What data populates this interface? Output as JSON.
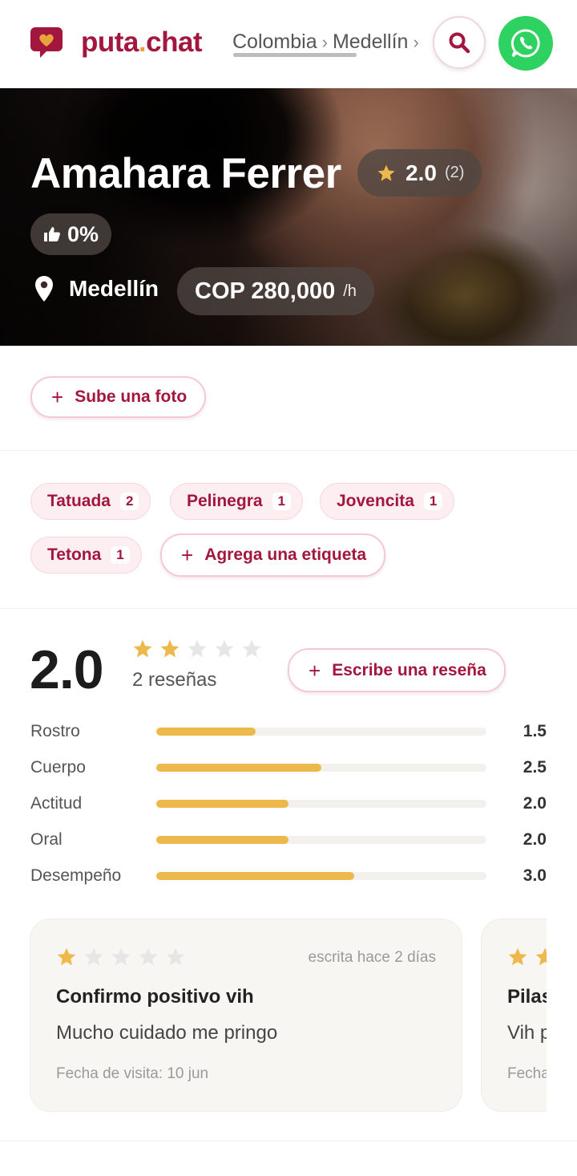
{
  "header": {
    "logo_text_main": "puta",
    "logo_text_dot": ".",
    "logo_text_tld": "chat",
    "breadcrumb": [
      "Colombia",
      "Medellín"
    ],
    "breadcrumb_sep": "›",
    "search_icon": "search-icon",
    "whatsapp_icon": "whatsapp-icon"
  },
  "profile": {
    "name": "Amahara Ferrer",
    "rating": "2.0",
    "rating_count": "(2)",
    "likes": "0%",
    "city": "Medellín",
    "price": "COP 280,000",
    "price_unit": "/h"
  },
  "actions": {
    "upload_photo": "Sube una foto",
    "add_tag": "Agrega una etiqueta",
    "write_review": "Escribe una reseña"
  },
  "tags": [
    {
      "label": "Tatuada",
      "count": "2"
    },
    {
      "label": "Pelinegra",
      "count": "1"
    },
    {
      "label": "Jovencita",
      "count": "1"
    },
    {
      "label": "Tetona",
      "count": "1"
    }
  ],
  "summary": {
    "average": "2.0",
    "stars_filled": 2,
    "stars_total": 5,
    "reviews_label": "2 reseñas"
  },
  "categories": [
    {
      "label": "Rostro",
      "value": "1.5",
      "fraction": 0.3
    },
    {
      "label": "Cuerpo",
      "value": "2.5",
      "fraction": 0.5
    },
    {
      "label": "Actitud",
      "value": "2.0",
      "fraction": 0.4
    },
    {
      "label": "Oral",
      "value": "2.0",
      "fraction": 0.4
    },
    {
      "label": "Desempeño",
      "value": "3.0",
      "fraction": 0.6
    }
  ],
  "reviews": [
    {
      "stars": 1,
      "date": "escrita hace 2 días",
      "title": "Confirmo positivo vih",
      "text": "Mucho cuidado me pringo",
      "visit": "Fecha de visita: 10 jun"
    },
    {
      "stars": 2,
      "date": "",
      "title": "Pilas",
      "text": "Vih p",
      "visit": "Fecha"
    }
  ],
  "colors": {
    "brand": "#a3173f",
    "accent": "#e8a33b",
    "star": "#eeb94c",
    "whatsapp": "#2dd260"
  }
}
